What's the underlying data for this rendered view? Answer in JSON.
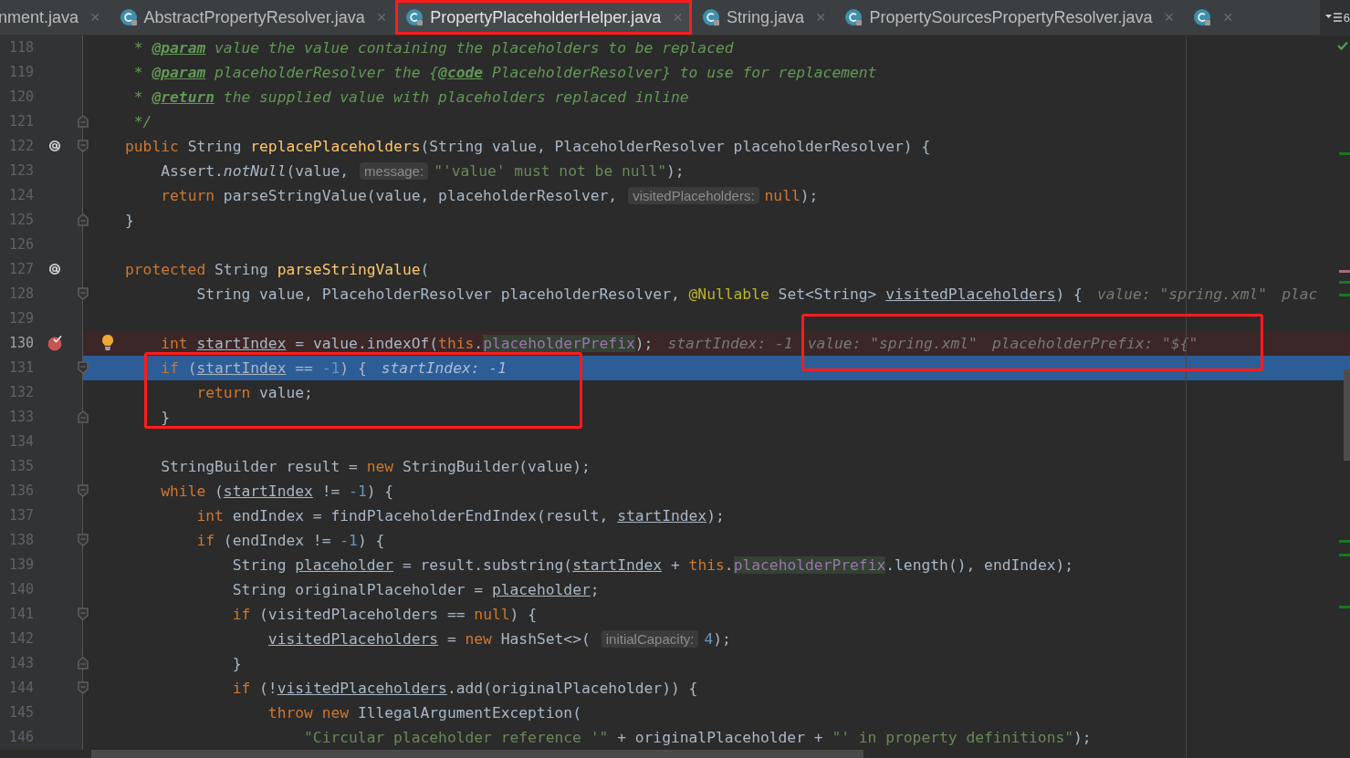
{
  "tabs": [
    {
      "label": "nment.java",
      "close": "×",
      "selected": false,
      "kind": "partial"
    },
    {
      "label": "AbstractPropertyResolver.java",
      "close": "×",
      "selected": false,
      "kind": "class"
    },
    {
      "label": "PropertyPlaceholderHelper.java",
      "close": "×",
      "selected": true,
      "kind": "class"
    },
    {
      "label": "String.java",
      "close": "×",
      "selected": false,
      "kind": "class"
    },
    {
      "label": "PropertySourcesPropertyResolver.java",
      "close": "×",
      "selected": false,
      "kind": "class"
    },
    {
      "close": "×",
      "selected": false,
      "kind": "class"
    }
  ],
  "tab_overflow": {
    "count": "6"
  },
  "lines": [
    {
      "number": "118",
      "selected": false,
      "parts": [
        {
          "kind": "code",
          "tokens": [
            {
              "kind": "comment",
              "text": " * "
            },
            {
              "kind": "doc-tag",
              "text": "@param"
            },
            {
              "kind": "comment",
              "text": " value the value containing the placeholders to be replaced"
            }
          ]
        }
      ]
    },
    {
      "number": "119",
      "selected": false,
      "parts": [
        {
          "kind": "code",
          "tokens": [
            {
              "kind": "comment",
              "text": " * "
            },
            {
              "kind": "doc-tag",
              "text": "@param"
            },
            {
              "kind": "comment",
              "text": " placeholderResolver the {"
            },
            {
              "kind": "doc-tag",
              "text": "@code"
            },
            {
              "kind": "comment",
              "text": " PlaceholderResolver} to use for replacement"
            }
          ]
        }
      ]
    },
    {
      "number": "120",
      "selected": false,
      "parts": [
        {
          "kind": "code",
          "tokens": [
            {
              "kind": "comment",
              "text": " * "
            },
            {
              "kind": "doc-tag",
              "text": "@return"
            },
            {
              "kind": "comment",
              "text": " the supplied value with placeholders replaced inline"
            }
          ]
        }
      ]
    },
    {
      "number": "121",
      "selected": false,
      "gutter": [
        {
          "kind": "fold-end"
        }
      ],
      "parts": [
        {
          "kind": "code",
          "tokens": [
            {
              "kind": "comment",
              "text": " */"
            }
          ]
        }
      ]
    },
    {
      "number": "122",
      "selected": false,
      "gutter": [
        {
          "kind": "override"
        },
        {
          "kind": "fold-start"
        }
      ],
      "parts": [
        {
          "kind": "code",
          "tokens": [
            {
              "kind": "keyword",
              "text": "public "
            },
            {
              "kind": "plain",
              "text": "String "
            },
            {
              "kind": "declaration",
              "text": "replacePlaceholders"
            },
            {
              "kind": "plain",
              "text": "(String value, PlaceholderResolver placeholderResolver) {"
            }
          ]
        }
      ]
    },
    {
      "number": "123",
      "selected": false,
      "parts": [
        {
          "kind": "code",
          "tokens": [
            {
              "kind": "plain",
              "text": "    Assert."
            },
            {
              "kind": "static-call",
              "text": "notNull"
            },
            {
              "kind": "plain",
              "text": "(value,"
            }
          ]
        },
        {
          "kind": "hint",
          "text": "message:"
        },
        {
          "kind": "code",
          "tokens": [
            {
              "kind": "string",
              "text": "\"'value' must not be null\""
            },
            {
              "kind": "plain",
              "text": ");"
            }
          ]
        }
      ]
    },
    {
      "number": "124",
      "selected": false,
      "parts": [
        {
          "kind": "code",
          "tokens": [
            {
              "kind": "keyword",
              "text": "    return "
            },
            {
              "kind": "plain",
              "text": "parseStringValue(value, placeholderResolver,"
            }
          ]
        },
        {
          "kind": "hint",
          "text": "visitedPlaceholders:"
        },
        {
          "kind": "code",
          "tokens": [
            {
              "kind": "keyword",
              "text": "null"
            },
            {
              "kind": "plain",
              "text": ");"
            }
          ]
        }
      ]
    },
    {
      "number": "125",
      "selected": false,
      "gutter": [
        {
          "kind": "fold-end"
        }
      ],
      "parts": [
        {
          "kind": "code",
          "tokens": [
            {
              "kind": "plain",
              "text": "}"
            }
          ]
        }
      ]
    },
    {
      "number": "126",
      "selected": false
    },
    {
      "number": "127",
      "selected": false,
      "gutter": [
        {
          "kind": "override"
        }
      ],
      "parts": [
        {
          "kind": "code",
          "tokens": [
            {
              "kind": "keyword",
              "text": "protected "
            },
            {
              "kind": "plain",
              "text": "String "
            },
            {
              "kind": "declaration",
              "text": "parseStringValue"
            },
            {
              "kind": "plain",
              "text": "("
            }
          ]
        }
      ]
    },
    {
      "number": "128",
      "selected": false,
      "gutter": [
        {
          "kind": "fold-start"
        }
      ],
      "parts": [
        {
          "kind": "code",
          "tokens": [
            {
              "kind": "plain",
              "text": "        String value, PlaceholderResolver placeholderResolver, "
            },
            {
              "kind": "annotation",
              "text": "@Nullable "
            },
            {
              "kind": "plain",
              "text": "Set<String> "
            },
            {
              "kind": "reassigned",
              "text": "visitedPlaceholders"
            },
            {
              "kind": "plain",
              "text": ") {"
            }
          ]
        },
        {
          "kind": "debug",
          "text": "value: \"spring.xml\""
        },
        {
          "kind": "debug",
          "text": "plac"
        }
      ]
    },
    {
      "number": "129",
      "selected": false
    },
    {
      "number": "130",
      "selected": false,
      "gutter": [
        {
          "kind": "breakpoint"
        }
      ],
      "intention": true,
      "parts": [
        {
          "kind": "code",
          "tokens": [
            {
              "kind": "keyword",
              "text": "    int "
            },
            {
              "kind": "reassigned",
              "text": "startIndex"
            },
            {
              "kind": "plain",
              "text": " = value.indexOf("
            },
            {
              "kind": "keyword",
              "text": "this"
            },
            {
              "kind": "plain",
              "text": "."
            },
            {
              "kind": "field",
              "text": "placeholderPrefix"
            },
            {
              "kind": "plain",
              "text": ");"
            }
          ]
        },
        {
          "kind": "debug",
          "text": "startIndex: -1"
        },
        {
          "kind": "debug",
          "text": "value: \"spring.xml\""
        },
        {
          "kind": "debug",
          "text": "placeholderPrefix: \"${\""
        }
      ]
    },
    {
      "number": "131",
      "selected": true,
      "gutter": [
        {
          "kind": "fold-start"
        }
      ],
      "parts": [
        {
          "kind": "code",
          "tokens": [
            {
              "kind": "keyword",
              "text": "    if "
            },
            {
              "kind": "plain",
              "text": "("
            },
            {
              "kind": "reassigned",
              "text": "startIndex"
            },
            {
              "kind": "plain",
              "text": " == "
            },
            {
              "kind": "number",
              "text": "-1"
            },
            {
              "kind": "plain",
              "text": ") {"
            }
          ]
        },
        {
          "kind": "debug",
          "text": "startIndex: -1"
        }
      ]
    },
    {
      "number": "132",
      "selected": false,
      "parts": [
        {
          "kind": "code",
          "tokens": [
            {
              "kind": "keyword",
              "text": "        return "
            },
            {
              "kind": "plain",
              "text": "value;"
            }
          ]
        }
      ]
    },
    {
      "number": "133",
      "selected": false,
      "gutter": [
        {
          "kind": "fold-end"
        }
      ],
      "parts": [
        {
          "kind": "code",
          "tokens": [
            {
              "kind": "plain",
              "text": "    }"
            }
          ]
        }
      ]
    },
    {
      "number": "134",
      "selected": false
    },
    {
      "number": "135",
      "selected": false,
      "parts": [
        {
          "kind": "code",
          "tokens": [
            {
              "kind": "plain",
              "text": "    StringBuilder result = "
            },
            {
              "kind": "keyword",
              "text": "new "
            },
            {
              "kind": "plain",
              "text": "StringBuilder(value);"
            }
          ]
        }
      ]
    },
    {
      "number": "136",
      "selected": false,
      "gutter": [
        {
          "kind": "fold-start"
        }
      ],
      "parts": [
        {
          "kind": "code",
          "tokens": [
            {
              "kind": "keyword",
              "text": "    while "
            },
            {
              "kind": "plain",
              "text": "("
            },
            {
              "kind": "reassigned",
              "text": "startIndex"
            },
            {
              "kind": "plain",
              "text": " != "
            },
            {
              "kind": "number",
              "text": "-1"
            },
            {
              "kind": "plain",
              "text": ") {"
            }
          ]
        }
      ]
    },
    {
      "number": "137",
      "selected": false,
      "parts": [
        {
          "kind": "code",
          "tokens": [
            {
              "kind": "keyword",
              "text": "        int "
            },
            {
              "kind": "plain",
              "text": "endIndex = findPlaceholderEndIndex(result, "
            },
            {
              "kind": "reassigned",
              "text": "startIndex"
            },
            {
              "kind": "plain",
              "text": ");"
            }
          ]
        }
      ]
    },
    {
      "number": "138",
      "selected": false,
      "gutter": [
        {
          "kind": "fold-start"
        }
      ],
      "parts": [
        {
          "kind": "code",
          "tokens": [
            {
              "kind": "keyword",
              "text": "        if "
            },
            {
              "kind": "plain",
              "text": "(endIndex != "
            },
            {
              "kind": "number",
              "text": "-1"
            },
            {
              "kind": "plain",
              "text": ") {"
            }
          ]
        }
      ]
    },
    {
      "number": "139",
      "selected": false,
      "parts": [
        {
          "kind": "code",
          "tokens": [
            {
              "kind": "plain",
              "text": "            String "
            },
            {
              "kind": "reassigned",
              "text": "placeholder"
            },
            {
              "kind": "plain",
              "text": " = result.substring("
            },
            {
              "kind": "reassigned",
              "text": "startIndex"
            },
            {
              "kind": "plain",
              "text": " + "
            },
            {
              "kind": "keyword",
              "text": "this"
            },
            {
              "kind": "plain",
              "text": "."
            },
            {
              "kind": "field",
              "text": "placeholderPrefix"
            },
            {
              "kind": "plain",
              "text": ".length(), endIndex);"
            }
          ]
        }
      ]
    },
    {
      "number": "140",
      "selected": false,
      "parts": [
        {
          "kind": "code",
          "tokens": [
            {
              "kind": "plain",
              "text": "            String originalPlaceholder = "
            },
            {
              "kind": "reassigned",
              "text": "placeholder"
            },
            {
              "kind": "plain",
              "text": ";"
            }
          ]
        }
      ]
    },
    {
      "number": "141",
      "selected": false,
      "gutter": [
        {
          "kind": "fold-start"
        }
      ],
      "parts": [
        {
          "kind": "code",
          "tokens": [
            {
              "kind": "keyword",
              "text": "            if "
            },
            {
              "kind": "plain",
              "text": "(visitedPlaceholders == "
            },
            {
              "kind": "keyword",
              "text": "null"
            },
            {
              "kind": "plain",
              "text": ") {"
            }
          ]
        }
      ]
    },
    {
      "number": "142",
      "selected": false,
      "parts": [
        {
          "kind": "code",
          "tokens": [
            {
              "kind": "reassigned",
              "text": "                visitedPlaceholders"
            },
            {
              "kind": "plain",
              "text": " = "
            },
            {
              "kind": "keyword",
              "text": "new "
            },
            {
              "kind": "plain",
              "text": "HashSet<>("
            }
          ]
        },
        {
          "kind": "hint",
          "text": "initialCapacity:"
        },
        {
          "kind": "code",
          "tokens": [
            {
              "kind": "number",
              "text": "4"
            },
            {
              "kind": "plain",
              "text": ");"
            }
          ]
        }
      ]
    },
    {
      "number": "143",
      "selected": false,
      "gutter": [
        {
          "kind": "fold-end"
        }
      ],
      "parts": [
        {
          "kind": "code",
          "tokens": [
            {
              "kind": "plain",
              "text": "            }"
            }
          ]
        }
      ]
    },
    {
      "number": "144",
      "selected": false,
      "gutter": [
        {
          "kind": "fold-start"
        }
      ],
      "parts": [
        {
          "kind": "code",
          "tokens": [
            {
              "kind": "keyword",
              "text": "            if "
            },
            {
              "kind": "plain",
              "text": "(!"
            },
            {
              "kind": "reassigned",
              "text": "visitedPlaceholders"
            },
            {
              "kind": "plain",
              "text": ".add(originalPlaceholder)) {"
            }
          ]
        }
      ]
    },
    {
      "number": "145",
      "selected": false,
      "parts": [
        {
          "kind": "code",
          "tokens": [
            {
              "kind": "keyword",
              "text": "                throw new "
            },
            {
              "kind": "plain",
              "text": "IllegalArgumentException("
            }
          ]
        }
      ]
    },
    {
      "number": "146",
      "selected": false,
      "parts": [
        {
          "kind": "code",
          "tokens": [
            {
              "kind": "string",
              "text": "                    \"Circular placeholder reference '\""
            },
            {
              "kind": "plain",
              "text": " + originalPlaceholder + "
            },
            {
              "kind": "string",
              "text": "\"' in property definitions\""
            },
            {
              "kind": "plain",
              "text": ");"
            }
          ]
        }
      ]
    }
  ]
}
